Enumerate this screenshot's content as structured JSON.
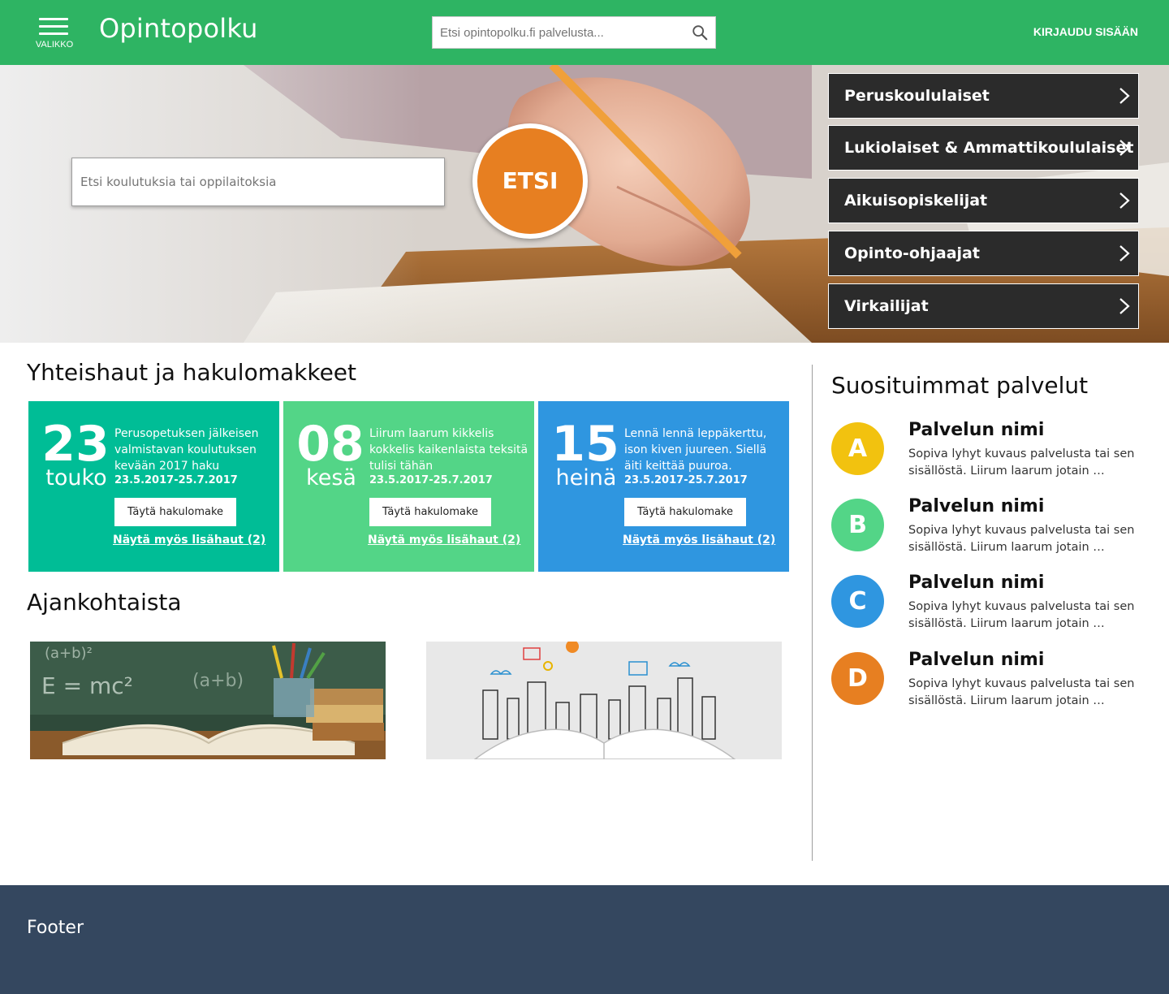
{
  "header": {
    "menu_label": "VALIKKO",
    "logo": "Opintopolku",
    "search_placeholder": "Etsi opintopolku.fi palvelusta...",
    "login_label": "KIRJAUDU SISÄÄN",
    "color": "#2eb463"
  },
  "hero": {
    "search_placeholder": "Etsi koulutuksia tai oppilaitoksia",
    "search_button": "ETSI",
    "roles": [
      {
        "label": "Peruskoululaiset"
      },
      {
        "label": "Lukiolaiset & Ammattikoululaiset"
      },
      {
        "label": "Aikuisopiskelijat"
      },
      {
        "label": "Opinto-ohjaajat"
      },
      {
        "label": "Virkailijat"
      }
    ]
  },
  "applications": {
    "title": "Yhteishaut ja hakulomakkeet",
    "cards": [
      {
        "day": "23",
        "month": "touko",
        "desc": "Perusopetuksen jälkeisen valmistavan koulutuksen kevään 2017 haku",
        "dates": "23.5.2017-25.7.2017",
        "button": "Täytä hakulomake",
        "more": "Näytä myös lisähaut (2)",
        "color": "#00bd96"
      },
      {
        "day": "08",
        "month": "kesä",
        "desc": "Liirum laarum kikkelis kokkelis kaikenlaista teksitä tulisi tähän",
        "dates": "23.5.2017-25.7.2017",
        "button": "Täytä hakulomake",
        "more": "Näytä myös lisähaut (2)",
        "color": "#53d587"
      },
      {
        "day": "15",
        "month": "heinä",
        "desc": "Lennä lennä leppäkerttu, ison kiven juureen. Siellä äiti keittää puuroa.",
        "dates": "23.5.2017-25.7.2017",
        "button": "Täytä hakulomake",
        "more": "Näytä myös lisähaut (2)",
        "color": "#2f96e0"
      }
    ]
  },
  "news": {
    "title": "Ajankohtaista"
  },
  "services": {
    "title": "Suosituimmat palvelut",
    "items": [
      {
        "letter": "A",
        "name": "Palvelun nimi",
        "desc": "Sopiva lyhyt kuvaus palvelusta tai sen sisällöstä. Liirum laarum jotain …",
        "color": "#f2c20f"
      },
      {
        "letter": "B",
        "name": "Palvelun nimi",
        "desc": "Sopiva lyhyt kuvaus palvelusta tai sen sisällöstä. Liirum laarum jotain …",
        "color": "#53d587"
      },
      {
        "letter": "C",
        "name": "Palvelun nimi",
        "desc": "Sopiva lyhyt kuvaus palvelusta tai sen sisällöstä. Liirum laarum jotain …",
        "color": "#2f96e0"
      },
      {
        "letter": "D",
        "name": "Palvelun nimi",
        "desc": "Sopiva lyhyt kuvaus palvelusta tai sen sisällöstä. Liirum laarum jotain …",
        "color": "#e77f21"
      }
    ]
  },
  "footer": {
    "label": "Footer",
    "color": "#34475f"
  }
}
